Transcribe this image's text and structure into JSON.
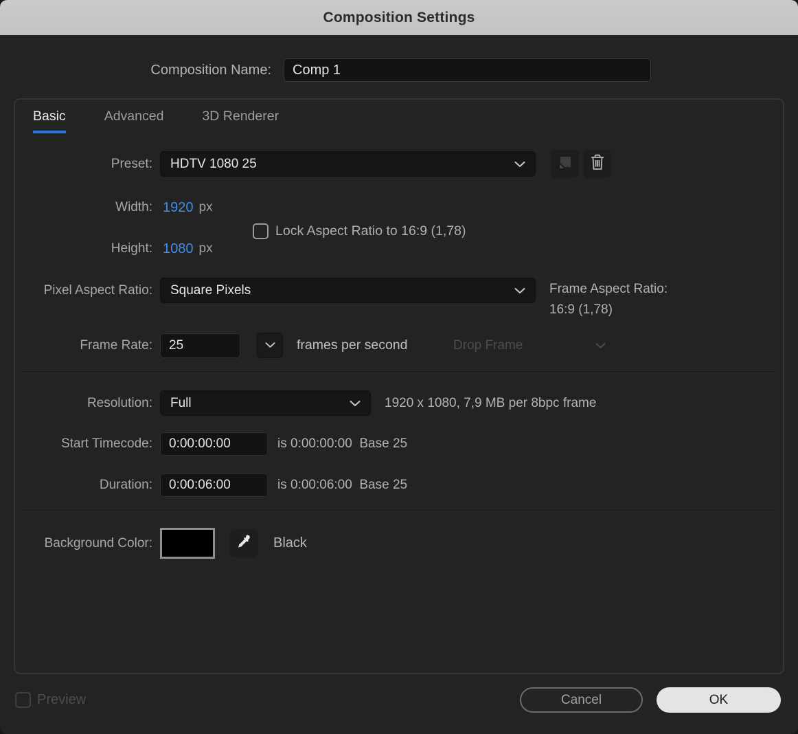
{
  "window": {
    "title": "Composition Settings"
  },
  "colors": {
    "accent_blue": "#3f8fe6",
    "tab_underline": "#2678e0",
    "titlebar_bg": "#c7c7c6",
    "dialog_bg": "#232323",
    "background_swatch": "#000000"
  },
  "composition_name": {
    "label": "Composition Name:",
    "value": "Comp 1"
  },
  "tabs": [
    {
      "label": "Basic",
      "active": true
    },
    {
      "label": "Advanced",
      "active": false
    },
    {
      "label": "3D Renderer",
      "active": false
    }
  ],
  "preset": {
    "label": "Preset:",
    "value": "HDTV 1080 25",
    "save_icon": "save-preset-icon",
    "delete_icon": "trash-icon",
    "chevron_icon": "chevron-down-icon"
  },
  "size": {
    "width_label": "Width:",
    "width_value": "1920",
    "width_unit": "px",
    "height_label": "Height:",
    "height_value": "1080",
    "height_unit": "px",
    "lock_aspect_label": "Lock Aspect Ratio to 16:9 (1,78)",
    "lock_aspect_checked": false
  },
  "pixel_aspect_ratio": {
    "label": "Pixel Aspect Ratio:",
    "value": "Square Pixels"
  },
  "frame_aspect_ratio": {
    "label": "Frame Aspect Ratio:",
    "value": "16:9 (1,78)"
  },
  "frame_rate": {
    "label": "Frame Rate:",
    "value": "25",
    "unit": "frames per second",
    "drop_frame_label": "Drop Frame",
    "drop_frame_enabled": false
  },
  "resolution": {
    "label": "Resolution:",
    "value": "Full",
    "info": "1920 x 1080, 7,9 MB per 8bpc frame"
  },
  "start_timecode": {
    "label": "Start Timecode:",
    "value": "0:00:00:00",
    "info": "is 0:00:00:00  Base 25"
  },
  "duration": {
    "label": "Duration:",
    "value": "0:00:06:00",
    "info": "is 0:00:06:00  Base 25"
  },
  "background_color": {
    "label": "Background Color:",
    "color_name": "Black",
    "swatch_hex": "#000000",
    "eyedropper_icon": "eyedropper-icon"
  },
  "footer": {
    "preview_label": "Preview",
    "preview_checked": false,
    "cancel_label": "Cancel",
    "ok_label": "OK"
  }
}
